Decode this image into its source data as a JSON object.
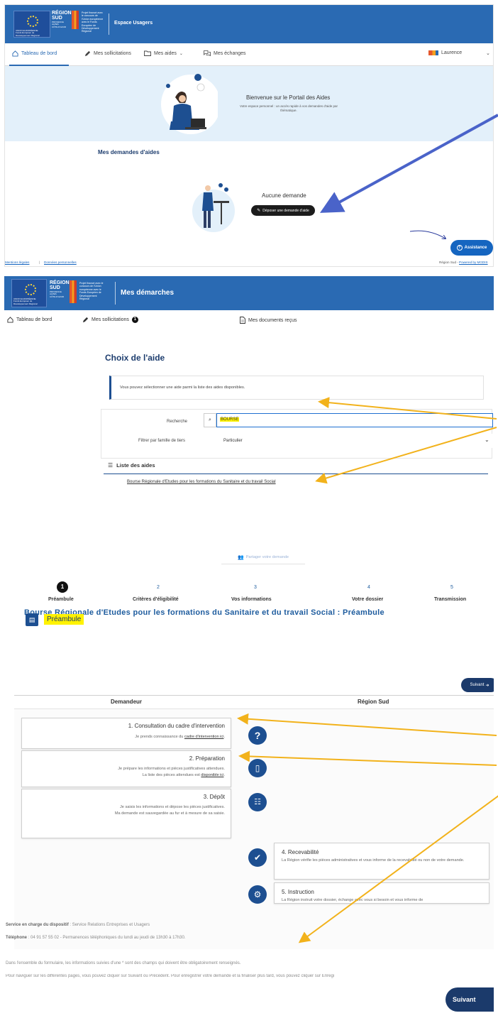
{
  "shot1": {
    "brand": {
      "region_big": "RÉGION\nSUD",
      "region_small": "PROVENCE\nALPES\nCÔTE D'AZUR",
      "eu_caption": "UNION EUROPÉENNE\nFonds Européen de\nDéveloppement Régional",
      "fund_text": "Projet financé avec le concours de l'Union européenne avec le Fonds Européen de Développement Régional",
      "app_title": "Espace Usagers"
    },
    "nav": {
      "dashboard": "Tableau de bord",
      "solicitations": "Mes sollicitations",
      "aids": "Mes aides",
      "exchanges": "Mes échanges",
      "user": "Laurence"
    },
    "hero": {
      "title": "Bienvenue sur le Portail des Aides",
      "subtitle": "Votre espace personnel : un accès rapide à vos demandes d'aide par thématique."
    },
    "requests": {
      "heading": "Mes demandes d'aides",
      "empty": "Aucune demande",
      "deposit_button": "Déposer une demande d'aide"
    },
    "assist_button": "Assistance",
    "footer": {
      "legal": "Mentions légales",
      "sep": "|",
      "personal": "Données personnelles",
      "right_prefix": "Région Sud - ",
      "powered": "Powered by MGDIS"
    }
  },
  "shot2": {
    "brand": {
      "app_title": "Mes démarches"
    },
    "nav": {
      "dashboard": "Tableau de bord",
      "solicitations": "Mes sollicitations",
      "solicitations_count": "1",
      "documents": "Mes documents reçus"
    },
    "choice": {
      "heading": "Choix de l'aide",
      "info": "Vous pouvez sélectionner une aide parmi la liste des aides disponibles.",
      "search_label": "Recherche",
      "search_value": "BOURSE",
      "filter_label": "Filtrer par famille de tiers",
      "filter_value": "Particulier",
      "list_heading": "Liste des aides",
      "list_item": "Bourse Régionale d'Etudes pour les formations du Sanitaire et du travail Social"
    },
    "form": {
      "title": "Bourse Régionale d'Etudes pour les formations du Sanitaire et du travail Social : Préambule",
      "share": "Partager votre demande",
      "steps": [
        {
          "num": "1",
          "label": "Préambule"
        },
        {
          "num": "2",
          "label": "Critères d'éligibilité"
        },
        {
          "num": "3",
          "label": "Vos informations"
        },
        {
          "num": "4",
          "label": "Votre dossier"
        },
        {
          "num": "5",
          "label": "Transmission"
        }
      ],
      "section": "Préambule",
      "next_small": "Suivant",
      "col_left": "Demandeur",
      "col_right": "Région Sud",
      "cards": [
        {
          "title": "1. Consultation du cadre d'intervention",
          "text_pre": "Je prends connaissance du ",
          "link": "cadre d'intervention ici",
          "text_post": "."
        },
        {
          "title": "2. Préparation",
          "text_line1": "Je prépare les informations et pièces justificatives attendues.",
          "text_pre": "La liste des pièces attendues est ",
          "link": "disponible ici",
          "text_post": "."
        },
        {
          "title": "3. Dépôt",
          "text_line1": "Je saisis les informations et dépose les pièces justificatives.",
          "text_line2": "Ma demande est sauvegardée au fur et à mesure de sa saisie."
        }
      ],
      "region_cards": [
        {
          "title": "4. Recevabilité",
          "text": "La Région vérifie les pièces administratives et vous informe de la recevabilité ou non de votre demande."
        },
        {
          "title": "5. Instruction",
          "text": "La Région instruit votre dossier, échange avec vous si besoin et vous informe de"
        }
      ],
      "service_label": "Service en charge du dispositif",
      "service_value": " : Service Relations Entreprises et Usagers",
      "phone_label": "Téléphone",
      "phone_value": " : 04 91 57 55 02 - Permanences téléphoniques du lundi au jeudi de 13h30 à 17h30.",
      "note1": "Dans l'ensemble du formulaire, les informations suivies d'une * sont des champs qui doivent être obligatoirement renseignés.",
      "note2": "Pour naviguer sur les différentes pages, vous pouvez cliquer sur Suivant ou Précédent. Pour enregistrer votre demande et la finaliser plus tard, vous pouvez cliquer sur Enregi",
      "next_large": "Suivant"
    }
  },
  "colors": {
    "header_blue": "#2a6ab3",
    "navy": "#1b3a6b",
    "arrow_blue": "#4a63c9",
    "arrow_orange": "#f2b21b",
    "highlight": "#fff200"
  }
}
